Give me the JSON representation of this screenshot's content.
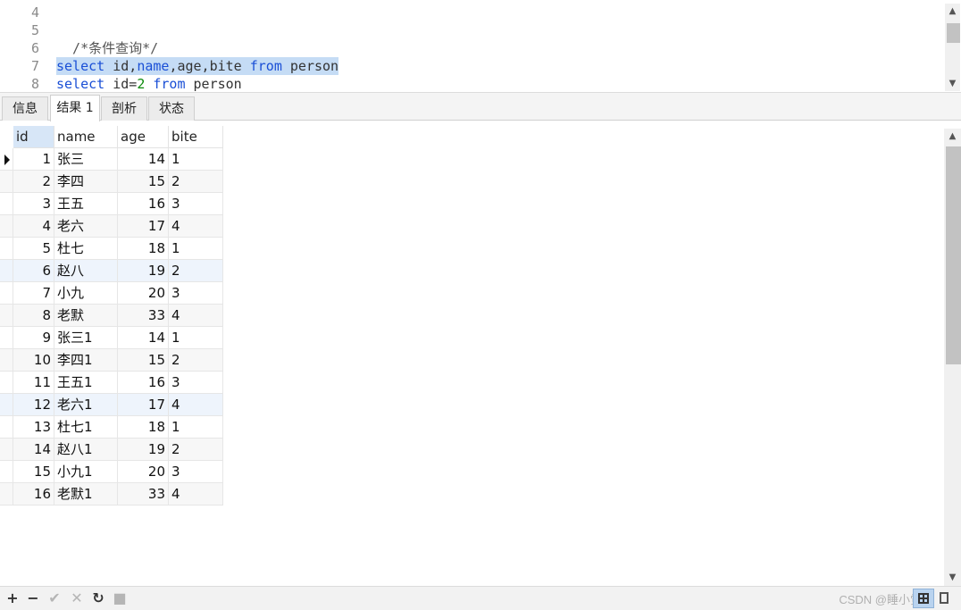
{
  "editor": {
    "lines": [
      {
        "n": "4",
        "tokens": []
      },
      {
        "n": "5",
        "tokens": []
      },
      {
        "n": "6",
        "tokens": [
          {
            "t": "  /*条件查询*/",
            "c": "cmt"
          }
        ]
      },
      {
        "n": "7",
        "selected": true,
        "tokens": [
          {
            "t": "select",
            "c": "kw"
          },
          {
            "t": " id,",
            "c": ""
          },
          {
            "t": "name",
            "c": "kw"
          },
          {
            "t": ",age,bite ",
            "c": ""
          },
          {
            "t": "from",
            "c": "kw"
          },
          {
            "t": " person",
            "c": ""
          }
        ]
      },
      {
        "n": "8",
        "tokens": [
          {
            "t": "select",
            "c": "kw"
          },
          {
            "t": " id=",
            "c": ""
          },
          {
            "t": "2",
            "c": "num"
          },
          {
            "t": " ",
            "c": ""
          },
          {
            "t": "from",
            "c": "kw"
          },
          {
            "t": " person",
            "c": ""
          }
        ]
      }
    ]
  },
  "tabs": [
    {
      "label": "信息",
      "active": false
    },
    {
      "label": "结果 1",
      "active": true
    },
    {
      "label": "剖析",
      "active": false
    },
    {
      "label": "状态",
      "active": false
    }
  ],
  "grid": {
    "columns": [
      "id",
      "name",
      "age",
      "bite"
    ],
    "rows": [
      [
        "1",
        "张三",
        "14",
        "1"
      ],
      [
        "2",
        "李四",
        "15",
        "2"
      ],
      [
        "3",
        "王五",
        "16",
        "3"
      ],
      [
        "4",
        "老六",
        "17",
        "4"
      ],
      [
        "5",
        "杜七",
        "18",
        "1"
      ],
      [
        "6",
        "赵八",
        "19",
        "2"
      ],
      [
        "7",
        "小九",
        "20",
        "3"
      ],
      [
        "8",
        "老默",
        "33",
        "4"
      ],
      [
        "9",
        "张三1",
        "14",
        "1"
      ],
      [
        "10",
        "李四1",
        "15",
        "2"
      ],
      [
        "11",
        "王五1",
        "16",
        "3"
      ],
      [
        "12",
        "老六1",
        "17",
        "4"
      ],
      [
        "13",
        "杜七1",
        "18",
        "1"
      ],
      [
        "14",
        "赵八1",
        "19",
        "2"
      ],
      [
        "15",
        "小九1",
        "20",
        "3"
      ],
      [
        "16",
        "老默1",
        "33",
        "4"
      ]
    ]
  },
  "toolbar": {
    "buttons": [
      {
        "name": "add-record-button",
        "glyph": "+",
        "enabled": true
      },
      {
        "name": "delete-record-button",
        "glyph": "−",
        "enabled": true
      },
      {
        "name": "apply-changes-button",
        "glyph": "✔",
        "enabled": false
      },
      {
        "name": "discard-changes-button",
        "glyph": "✕",
        "enabled": false
      },
      {
        "name": "refresh-button",
        "glyph": "↻",
        "enabled": true
      },
      {
        "name": "stop-button",
        "glyph": "■",
        "enabled": false
      }
    ],
    "watermark": "CSDN @睡小觉"
  },
  "colors": {
    "keyword": "#1a4fd6",
    "selection": "#c5dcf5",
    "active_header": "#d7e6f7"
  }
}
